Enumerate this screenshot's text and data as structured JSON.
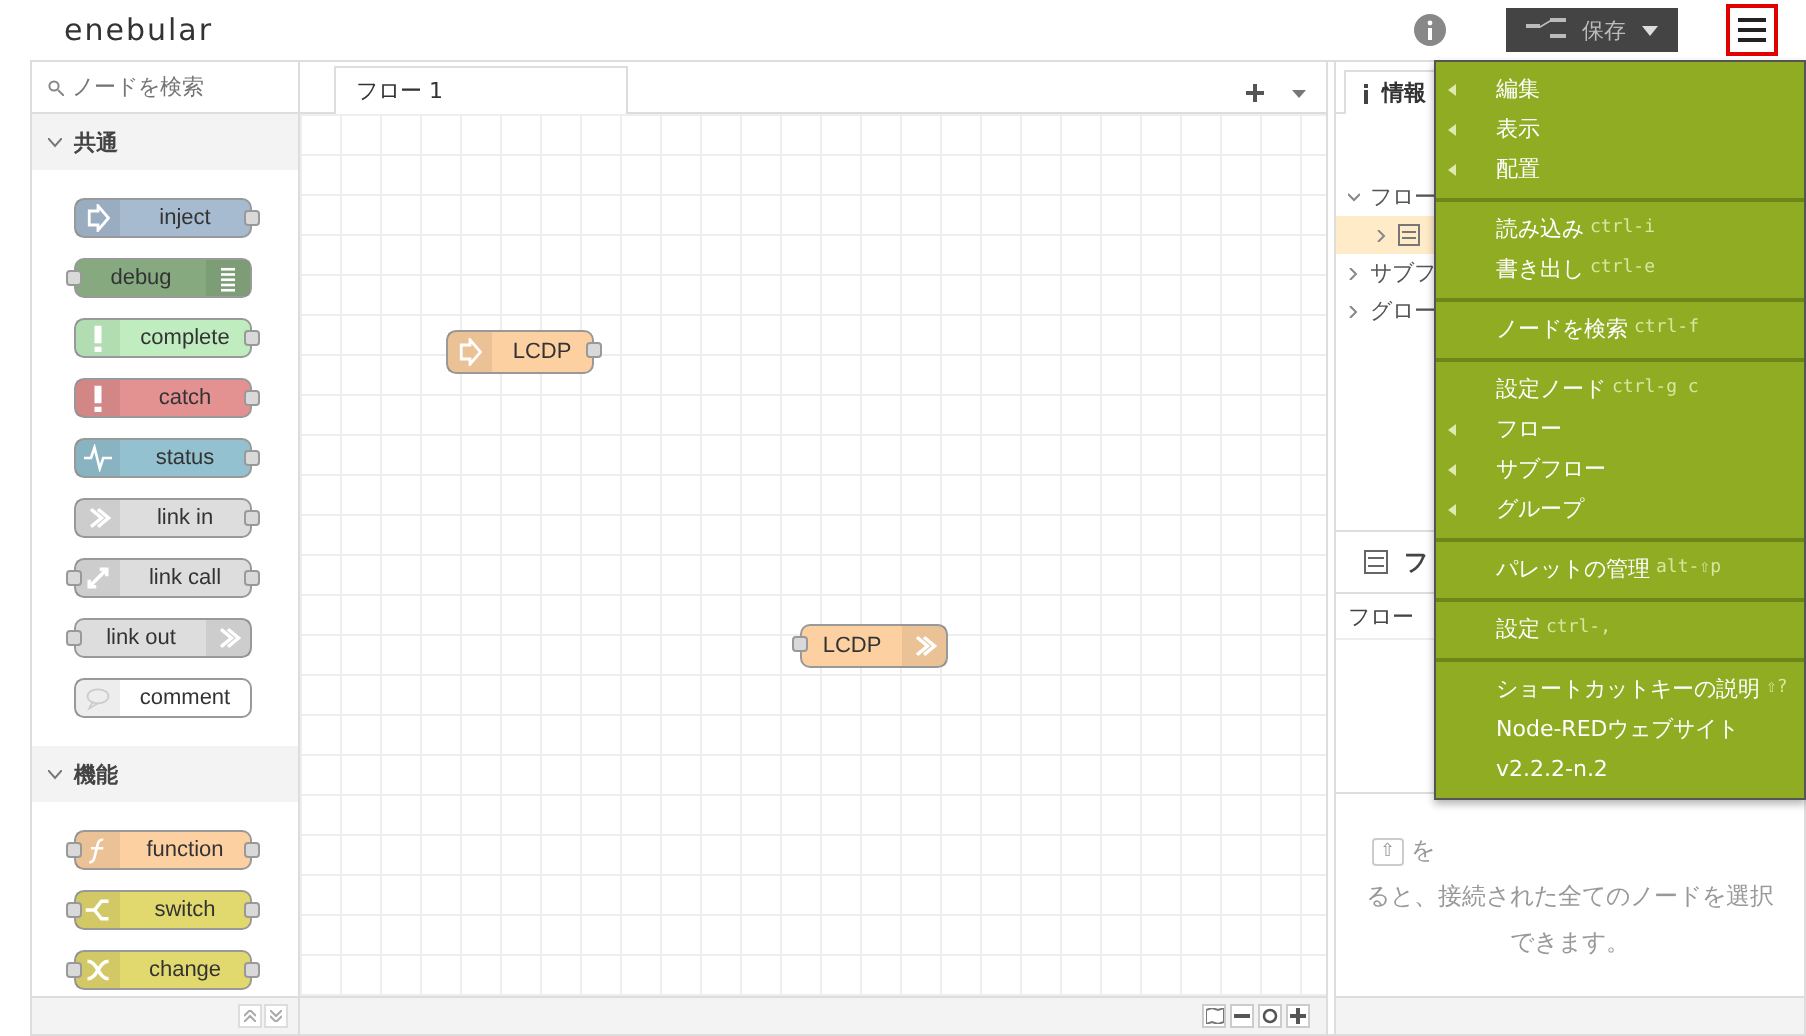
{
  "header": {
    "logo": "enebular",
    "save_button": {
      "label": "保存"
    },
    "menu_button": {
      "highlighted": true
    }
  },
  "palette": {
    "search": {
      "placeholder": "ノードを検索"
    },
    "categories": [
      {
        "label": "共通",
        "expanded": true,
        "nodes": [
          {
            "label": "inject",
            "color": "#a6bbcf",
            "kind": "inject",
            "input": false,
            "output": true
          },
          {
            "label": "debug",
            "color": "#87a980",
            "kind": "debug",
            "input": true,
            "output": false
          },
          {
            "label": "complete",
            "color": "#c0edc0",
            "kind": "alert",
            "input": false,
            "output": true
          },
          {
            "label": "catch",
            "color": "#e49191",
            "kind": "alert",
            "input": false,
            "output": true
          },
          {
            "label": "status",
            "color": "#94c1d0",
            "kind": "status",
            "input": false,
            "output": true
          },
          {
            "label": "link in",
            "color": "#dddddd",
            "kind": "linkin",
            "input": false,
            "output": true
          },
          {
            "label": "link call",
            "color": "#dddddd",
            "kind": "linkcall",
            "input": true,
            "output": true
          },
          {
            "label": "link out",
            "color": "#dddddd",
            "kind": "linkout",
            "input": true,
            "output": false
          },
          {
            "label": "comment",
            "color": "#ffffff",
            "kind": "comment",
            "input": false,
            "output": false
          }
        ]
      },
      {
        "label": "機能",
        "expanded": true,
        "nodes": [
          {
            "label": "function",
            "color": "#fdd0a2",
            "kind": "function",
            "input": true,
            "output": true
          },
          {
            "label": "switch",
            "color": "#e2d96e",
            "kind": "switch",
            "input": true,
            "output": true
          },
          {
            "label": "change",
            "color": "#e2d96e",
            "kind": "change",
            "input": true,
            "output": true
          }
        ]
      }
    ]
  },
  "workspace": {
    "tabs": [
      {
        "label": "フロー 1",
        "selected": true
      }
    ],
    "nodes": [
      {
        "label": "LCDP",
        "color": "#fdd0a2",
        "kind": "inject",
        "input": false,
        "output": true
      },
      {
        "label": "LCDP",
        "color": "#fdd0a2",
        "kind": "linkout",
        "input": true,
        "output": false
      }
    ]
  },
  "sidebar": {
    "tabs": [
      {
        "label": "情報",
        "selected": true
      }
    ],
    "tree": [
      {
        "label": "フロー",
        "expanded": true,
        "children": [
          {
            "selected": true
          }
        ]
      },
      {
        "label": "サブフ",
        "expanded": false
      },
      {
        "label": "グロー",
        "expanded": false
      }
    ],
    "section_title": "フ",
    "section_row": "フロー",
    "help_key": "⇧",
    "help_lines": [
      "を",
      "ると、接続された全てのノードを選択",
      "できます。"
    ]
  },
  "menu": {
    "groups": [
      [
        {
          "label": "編集",
          "submenu": true
        },
        {
          "label": "表示",
          "submenu": true
        },
        {
          "label": "配置",
          "submenu": true
        }
      ],
      [
        {
          "label": "読み込み",
          "shortcut": "ctrl-i",
          "submenu": false
        },
        {
          "label": "書き出し",
          "shortcut": "ctrl-e",
          "submenu": false
        }
      ],
      [
        {
          "label": "ノードを検索",
          "shortcut": "ctrl-f",
          "submenu": false
        }
      ],
      [
        {
          "label": "設定ノード",
          "shortcut": "ctrl-g c",
          "submenu": false
        },
        {
          "label": "フロー",
          "submenu": true
        },
        {
          "label": "サブフロー",
          "submenu": true
        },
        {
          "label": "グループ",
          "submenu": true
        }
      ],
      [
        {
          "label": "パレットの管理",
          "shortcut": "alt-⇧p",
          "submenu": false
        }
      ],
      [
        {
          "label": "設定",
          "shortcut": "ctrl-,",
          "submenu": false
        }
      ],
      [
        {
          "label": "ショートカットキーの説明",
          "shortcut": "⇧?",
          "submenu": false
        },
        {
          "label": "Node-REDウェブサイト",
          "submenu": false
        },
        {
          "label": "v2.2.2-n.2",
          "submenu": false
        }
      ]
    ]
  }
}
